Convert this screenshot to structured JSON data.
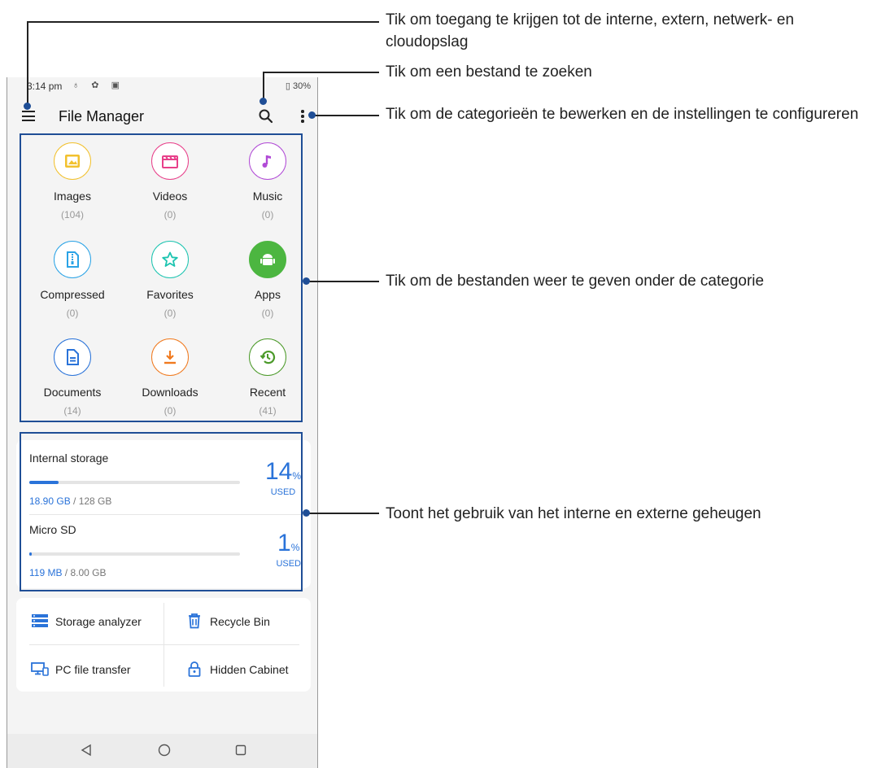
{
  "status_bar": {
    "time": "3:14 pm",
    "left_icons": "♁ ✿ ▣",
    "battery": "30%"
  },
  "app_bar": {
    "title": "File Manager",
    "icons": [
      "menu-icon",
      "search-icon",
      "more-vert-icon"
    ]
  },
  "categories": [
    {
      "label": "Images",
      "count": "(104)",
      "icon": "image-icon",
      "color": "#f2c12e"
    },
    {
      "label": "Videos",
      "count": "(0)",
      "icon": "video-icon",
      "color": "#e8408a"
    },
    {
      "label": "Music",
      "count": "(0)",
      "icon": "music-icon",
      "color": "#b14bd6"
    },
    {
      "label": "Compressed",
      "count": "(0)",
      "icon": "zip-icon",
      "color": "#2aa3e6"
    },
    {
      "label": "Favorites",
      "count": "(0)",
      "icon": "star-icon",
      "color": "#1cc4b0"
    },
    {
      "label": "Apps",
      "count": "(0)",
      "icon": "android-icon",
      "color": "#4cb640"
    },
    {
      "label": "Documents",
      "count": "(14)",
      "icon": "document-icon",
      "color": "#2a73d9"
    },
    {
      "label": "Downloads",
      "count": "(0)",
      "icon": "download-icon",
      "color": "#f07a1f"
    },
    {
      "label": "Recent",
      "count": "(41)",
      "icon": "history-icon",
      "color": "#4c9a2a"
    }
  ],
  "storage": [
    {
      "name": "Internal storage",
      "used": "18.90 GB",
      "total": " / 128 GB",
      "percent": "14",
      "percent_sign": "%",
      "used_label": "USED",
      "fill_fraction": 0.14
    },
    {
      "name": "Micro SD",
      "used": "119 MB",
      "total": " / 8.00 GB",
      "percent": "1",
      "percent_sign": "%",
      "used_label": "USED",
      "fill_fraction": 0.01
    }
  ],
  "tools": [
    {
      "label": "Storage analyzer",
      "icon": "storage-analyzer-icon"
    },
    {
      "label": "Recycle Bin",
      "icon": "trash-icon"
    },
    {
      "label": "PC file transfer",
      "icon": "pc-transfer-icon"
    },
    {
      "label": "Hidden Cabinet",
      "icon": "lock-icon"
    }
  ],
  "nav": [
    "back-icon",
    "home-icon",
    "recents-icon"
  ],
  "callouts": [
    {
      "text": "Tik om toegang te krijgen tot de interne, extern, netwerk- en cloudopslag"
    },
    {
      "text": "Tik om een bestand te zoeken"
    },
    {
      "text": "Tik om de categorieën te bewerken en de instellingen te configureren"
    },
    {
      "text": "Tik om de bestanden weer te geven onder de categorie"
    },
    {
      "text": "Toont het gebruik van het interne en externe geheugen"
    }
  ],
  "colors": {
    "accent": "#2a73d9",
    "highlight": "#1f4e96"
  }
}
